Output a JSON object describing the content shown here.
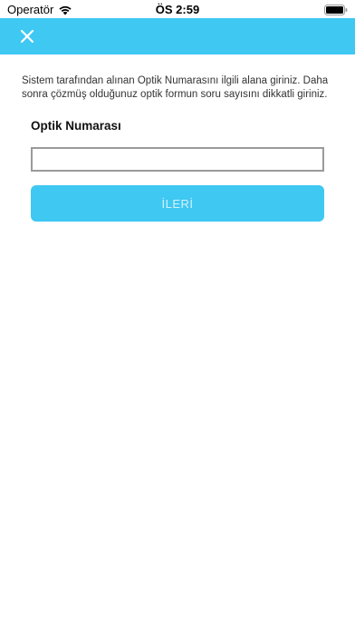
{
  "status_bar": {
    "carrier": "Operatör",
    "time": "ÖS 2:59",
    "icons": [
      "wifi-icon",
      "battery-icon"
    ]
  },
  "header": {
    "close_icon": "close-icon",
    "color": "#3ec8f2"
  },
  "form": {
    "instructions": "Sistem tarafından alınan Optik Numarasını ilgili alana giriniz. Daha sonra çözmüş olduğunuz optik formun soru sayısını dikkatli giriniz.",
    "field_label": "Optik Numarası",
    "field_value": "",
    "field_placeholder": "",
    "next_label": "İLERİ",
    "next_button_color": "#3ec8f2"
  }
}
